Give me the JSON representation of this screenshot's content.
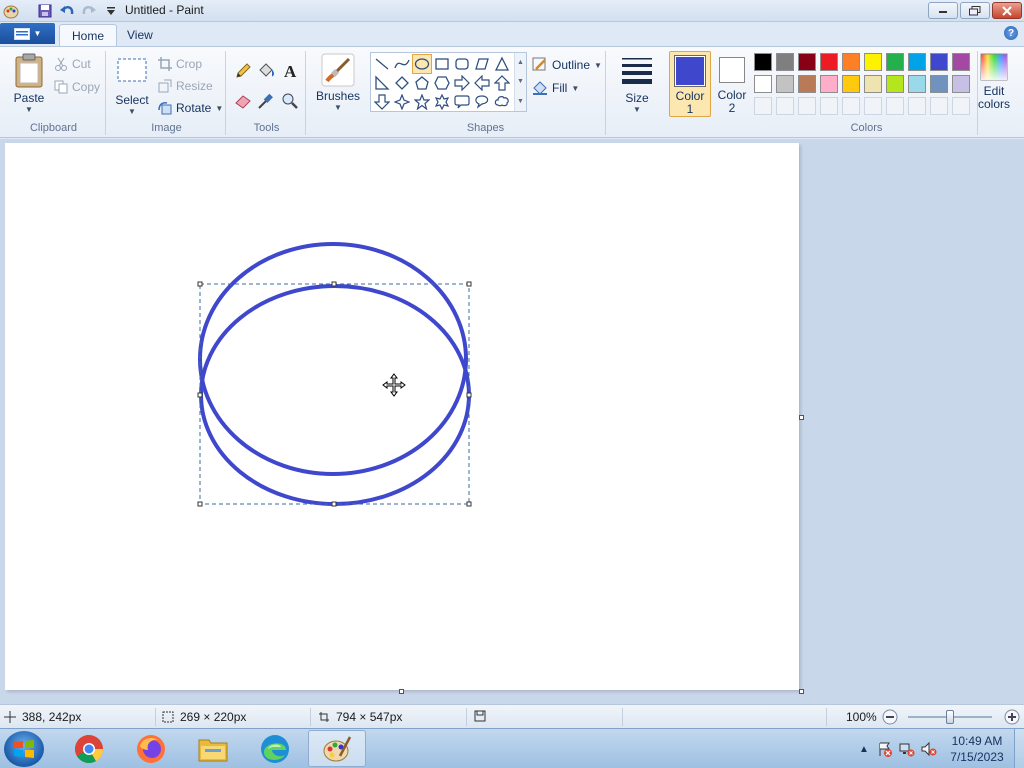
{
  "window": {
    "title": "Untitled - Paint"
  },
  "tabs": [
    {
      "label": "Home",
      "active": true
    },
    {
      "label": "View",
      "active": false
    }
  ],
  "ribbon": {
    "clipboard": {
      "label": "Clipboard",
      "paste": "Paste",
      "cut": "Cut",
      "copy": "Copy"
    },
    "image": {
      "label": "Image",
      "select": "Select",
      "crop": "Crop",
      "resize": "Resize",
      "rotate": "Rotate"
    },
    "tools": {
      "label": "Tools"
    },
    "brushes": {
      "label": "Brushes"
    },
    "shapes": {
      "label": "Shapes",
      "outline": "Outline",
      "fill": "Fill",
      "selected_shape": "oval"
    },
    "size": {
      "label": "Size"
    },
    "color1": {
      "line1": "Color",
      "line2": "1",
      "value": "#3f48cc"
    },
    "color2": {
      "line1": "Color",
      "line2": "2",
      "value": "#ffffff"
    },
    "colors": {
      "label": "Colors",
      "edit_line1": "Edit",
      "edit_line2": "colors"
    },
    "palette_row1": [
      "#000000",
      "#7f7f7f",
      "#880015",
      "#ed1c24",
      "#ff7f27",
      "#fff200",
      "#22b14c",
      "#00a2e8",
      "#3f48cc",
      "#a349a4"
    ],
    "palette_row2": [
      "#ffffff",
      "#c3c3c3",
      "#b97a57",
      "#ffaec9",
      "#ffc90e",
      "#efe4b0",
      "#b5e61d",
      "#99d9ea",
      "#7092be",
      "#c8bfe7"
    ]
  },
  "status": {
    "cursor_pos": "388, 242px",
    "selection_size": "269 × 220px",
    "canvas_size": "794 × 547px",
    "zoom": "100%"
  },
  "taskbar": {
    "apps": [
      "Chrome",
      "Firefox",
      "File Explorer",
      "Edge",
      "Paint"
    ],
    "active_app": "Paint",
    "time": "10:49 AM",
    "date": "7/15/2023"
  },
  "drawing": {
    "stroke_color": "#3f48cc"
  }
}
